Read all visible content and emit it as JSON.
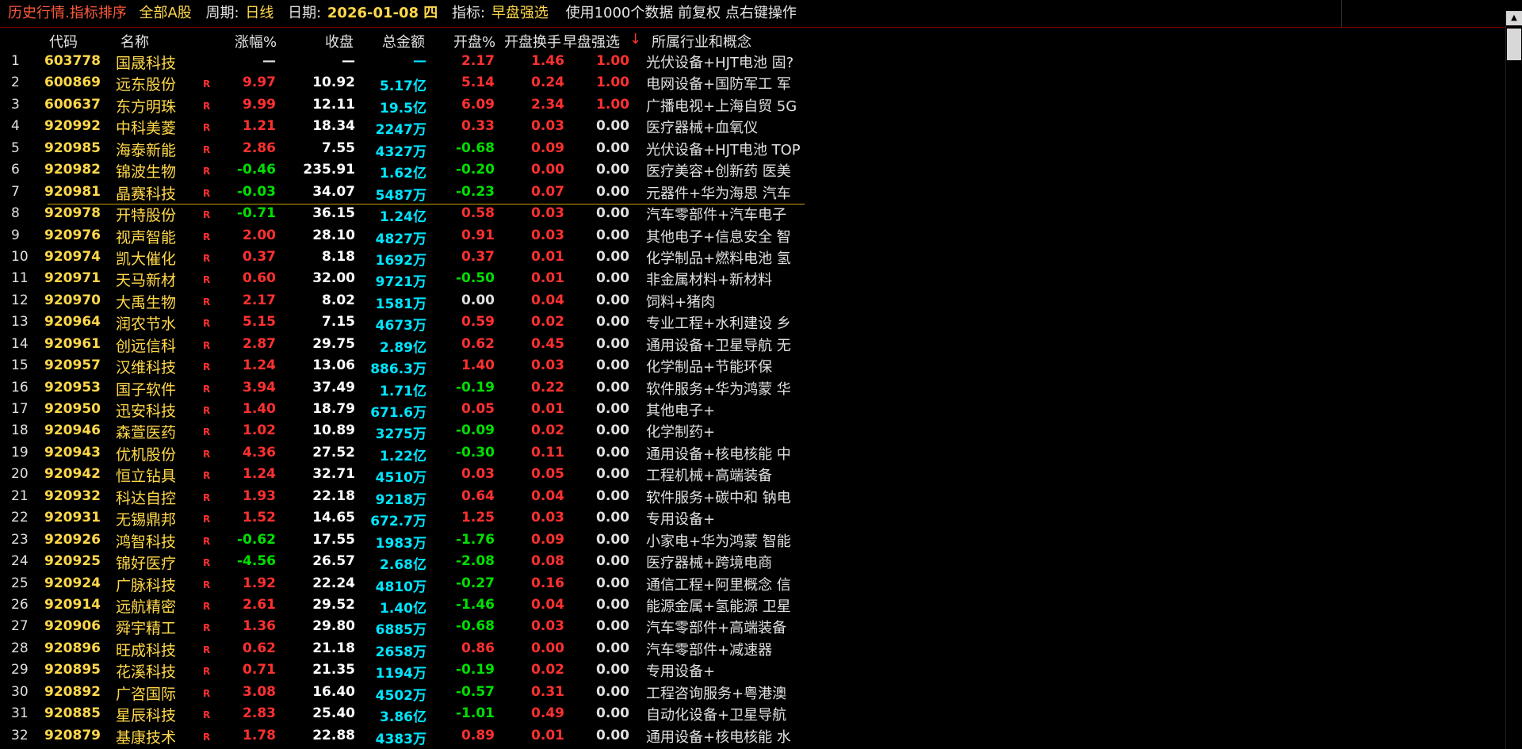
{
  "topbar": {
    "title": "历史行情.指标排序",
    "market": "全部A股",
    "period_label": "周期:",
    "period_value": "日线",
    "date_label": "日期:",
    "date_value": "2026-01-08 四",
    "indicator_label": "指标:",
    "indicator_value": "早盘强选",
    "info": "使用1000个数据 前复权 点右键操作"
  },
  "header": {
    "code": "代码",
    "name": "名称",
    "change": "涨幅%",
    "close": "收盘",
    "amount": "总金额",
    "open": "开盘%",
    "turnover": "开盘换手",
    "indicator": "早盘强选",
    "sort_arrow": "↓",
    "sector": "所属行业和概念"
  },
  "rows": [
    {
      "idx": "1",
      "code": "603778",
      "name": "国晟科技",
      "r": "",
      "chg": "—",
      "close": "—",
      "amt": "—",
      "open": "2.17",
      "turn": "1.46",
      "ind": "1.00",
      "sector": "光伏设备+HJT电池 固?"
    },
    {
      "idx": "2",
      "code": "600869",
      "name": "远东股份",
      "r": "R",
      "chg": "9.97",
      "close": "10.92",
      "amt": "5.17亿",
      "open": "5.14",
      "turn": "0.24",
      "ind": "1.00",
      "sector": "电网设备+国防军工 军"
    },
    {
      "idx": "3",
      "code": "600637",
      "name": "东方明珠",
      "r": "R",
      "chg": "9.99",
      "close": "12.11",
      "amt": "19.5亿",
      "open": "6.09",
      "turn": "2.34",
      "ind": "1.00",
      "sector": "广播电视+上海自贸 5G"
    },
    {
      "idx": "4",
      "code": "920992",
      "name": "中科美菱",
      "r": "R",
      "chg": "1.21",
      "close": "18.34",
      "amt": "2247万",
      "open": "0.33",
      "turn": "0.03",
      "ind": "0.00",
      "sector": "医疗器械+血氧仪"
    },
    {
      "idx": "5",
      "code": "920985",
      "name": "海泰新能",
      "r": "R",
      "chg": "2.86",
      "close": "7.55",
      "amt": "4327万",
      "open": "-0.68",
      "turn": "0.09",
      "ind": "0.00",
      "sector": "光伏设备+HJT电池 TOP"
    },
    {
      "idx": "6",
      "code": "920982",
      "name": "锦波生物",
      "r": "R",
      "chg": "-0.46",
      "close": "235.91",
      "amt": "1.62亿",
      "open": "-0.20",
      "turn": "0.00",
      "ind": "0.00",
      "sector": "医疗美容+创新药 医美"
    },
    {
      "idx": "7",
      "code": "920981",
      "name": "晶赛科技",
      "r": "R",
      "chg": "-0.03",
      "close": "34.07",
      "amt": "5487万",
      "open": "-0.23",
      "turn": "0.07",
      "ind": "0.00",
      "sector": "元器件+华为海思 汽车"
    },
    {
      "idx": "8",
      "code": "920978",
      "name": "开特股份",
      "r": "R",
      "chg": "-0.71",
      "close": "36.15",
      "amt": "1.24亿",
      "open": "0.58",
      "turn": "0.03",
      "ind": "0.00",
      "sector": "汽车零部件+汽车电子"
    },
    {
      "idx": "9",
      "code": "920976",
      "name": "视声智能",
      "r": "R",
      "chg": "2.00",
      "close": "28.10",
      "amt": "4827万",
      "open": "0.91",
      "turn": "0.03",
      "ind": "0.00",
      "sector": "其他电子+信息安全 智"
    },
    {
      "idx": "10",
      "code": "920974",
      "name": "凯大催化",
      "r": "R",
      "chg": "0.37",
      "close": "8.18",
      "amt": "1692万",
      "open": "0.37",
      "turn": "0.01",
      "ind": "0.00",
      "sector": "化学制品+燃料电池 氢"
    },
    {
      "idx": "11",
      "code": "920971",
      "name": "天马新材",
      "r": "R",
      "chg": "0.60",
      "close": "32.00",
      "amt": "9721万",
      "open": "-0.50",
      "turn": "0.01",
      "ind": "0.00",
      "sector": "非金属材料+新材料"
    },
    {
      "idx": "12",
      "code": "920970",
      "name": "大禹生物",
      "r": "R",
      "chg": "2.17",
      "close": "8.02",
      "amt": "1581万",
      "open": "0.00",
      "turn": "0.04",
      "ind": "0.00",
      "sector": "饲料+猪肉"
    },
    {
      "idx": "13",
      "code": "920964",
      "name": "润农节水",
      "r": "R",
      "chg": "5.15",
      "close": "7.15",
      "amt": "4673万",
      "open": "0.59",
      "turn": "0.02",
      "ind": "0.00",
      "sector": "专业工程+水利建设 乡"
    },
    {
      "idx": "14",
      "code": "920961",
      "name": "创远信科",
      "r": "R",
      "chg": "2.87",
      "close": "29.75",
      "amt": "2.89亿",
      "open": "0.62",
      "turn": "0.45",
      "ind": "0.00",
      "sector": "通用设备+卫星导航 无"
    },
    {
      "idx": "15",
      "code": "920957",
      "name": "汉维科技",
      "r": "R",
      "chg": "1.24",
      "close": "13.06",
      "amt": "886.3万",
      "open": "1.40",
      "turn": "0.03",
      "ind": "0.00",
      "sector": "化学制品+节能环保"
    },
    {
      "idx": "16",
      "code": "920953",
      "name": "国子软件",
      "r": "R",
      "chg": "3.94",
      "close": "37.49",
      "amt": "1.71亿",
      "open": "-0.19",
      "turn": "0.22",
      "ind": "0.00",
      "sector": "软件服务+华为鸿蒙 华"
    },
    {
      "idx": "17",
      "code": "920950",
      "name": "迅安科技",
      "r": "R",
      "chg": "1.40",
      "close": "18.79",
      "amt": "671.6万",
      "open": "0.05",
      "turn": "0.01",
      "ind": "0.00",
      "sector": "其他电子+"
    },
    {
      "idx": "18",
      "code": "920946",
      "name": "森萱医药",
      "r": "R",
      "chg": "1.02",
      "close": "10.89",
      "amt": "3275万",
      "open": "-0.09",
      "turn": "0.02",
      "ind": "0.00",
      "sector": "化学制药+"
    },
    {
      "idx": "19",
      "code": "920943",
      "name": "优机股份",
      "r": "R",
      "chg": "4.36",
      "close": "27.52",
      "amt": "1.22亿",
      "open": "-0.30",
      "turn": "0.11",
      "ind": "0.00",
      "sector": "通用设备+核电核能 中"
    },
    {
      "idx": "20",
      "code": "920942",
      "name": "恒立钻具",
      "r": "R",
      "chg": "1.24",
      "close": "32.71",
      "amt": "4510万",
      "open": "0.03",
      "turn": "0.05",
      "ind": "0.00",
      "sector": "工程机械+高端装备"
    },
    {
      "idx": "21",
      "code": "920932",
      "name": "科达自控",
      "r": "R",
      "chg": "1.93",
      "close": "22.18",
      "amt": "9218万",
      "open": "0.64",
      "turn": "0.04",
      "ind": "0.00",
      "sector": "软件服务+碳中和 钠电"
    },
    {
      "idx": "22",
      "code": "920931",
      "name": "无锡鼎邦",
      "r": "R",
      "chg": "1.52",
      "close": "14.65",
      "amt": "672.7万",
      "open": "1.25",
      "turn": "0.03",
      "ind": "0.00",
      "sector": "专用设备+"
    },
    {
      "idx": "23",
      "code": "920926",
      "name": "鸿智科技",
      "r": "R",
      "chg": "-0.62",
      "close": "17.55",
      "amt": "1983万",
      "open": "-1.76",
      "turn": "0.09",
      "ind": "0.00",
      "sector": "小家电+华为鸿蒙 智能"
    },
    {
      "idx": "24",
      "code": "920925",
      "name": "锦好医疗",
      "r": "R",
      "chg": "-4.56",
      "close": "26.57",
      "amt": "2.68亿",
      "open": "-2.08",
      "turn": "0.08",
      "ind": "0.00",
      "sector": "医疗器械+跨境电商"
    },
    {
      "idx": "25",
      "code": "920924",
      "name": "广脉科技",
      "r": "R",
      "chg": "1.92",
      "close": "22.24",
      "amt": "4810万",
      "open": "-0.27",
      "turn": "0.16",
      "ind": "0.00",
      "sector": "通信工程+阿里概念 信"
    },
    {
      "idx": "26",
      "code": "920914",
      "name": "远航精密",
      "r": "R",
      "chg": "2.61",
      "close": "29.52",
      "amt": "1.40亿",
      "open": "-1.46",
      "turn": "0.04",
      "ind": "0.00",
      "sector": "能源金属+氢能源 卫星"
    },
    {
      "idx": "27",
      "code": "920906",
      "name": "舜宇精工",
      "r": "R",
      "chg": "1.36",
      "close": "29.80",
      "amt": "6885万",
      "open": "-0.68",
      "turn": "0.03",
      "ind": "0.00",
      "sector": "汽车零部件+高端装备"
    },
    {
      "idx": "28",
      "code": "920896",
      "name": "旺成科技",
      "r": "R",
      "chg": "0.62",
      "close": "21.18",
      "amt": "2658万",
      "open": "0.86",
      "turn": "0.00",
      "ind": "0.00",
      "sector": "汽车零部件+减速器"
    },
    {
      "idx": "29",
      "code": "920895",
      "name": "花溪科技",
      "r": "R",
      "chg": "0.71",
      "close": "21.35",
      "amt": "1194万",
      "open": "-0.19",
      "turn": "0.02",
      "ind": "0.00",
      "sector": "专用设备+"
    },
    {
      "idx": "30",
      "code": "920892",
      "name": "广咨国际",
      "r": "R",
      "chg": "3.08",
      "close": "16.40",
      "amt": "4502万",
      "open": "-0.57",
      "turn": "0.31",
      "ind": "0.00",
      "sector": "工程咨询服务+粤港澳"
    },
    {
      "idx": "31",
      "code": "920885",
      "name": "星辰科技",
      "r": "R",
      "chg": "2.83",
      "close": "25.40",
      "amt": "3.86亿",
      "open": "-1.01",
      "turn": "0.49",
      "ind": "0.00",
      "sector": "自动化设备+卫星导航"
    },
    {
      "idx": "32",
      "code": "920879",
      "name": "基康技术",
      "r": "R",
      "chg": "1.78",
      "close": "22.88",
      "amt": "4383万",
      "open": "0.89",
      "turn": "0.01",
      "ind": "0.00",
      "sector": "通用设备+核电核能 水"
    }
  ]
}
